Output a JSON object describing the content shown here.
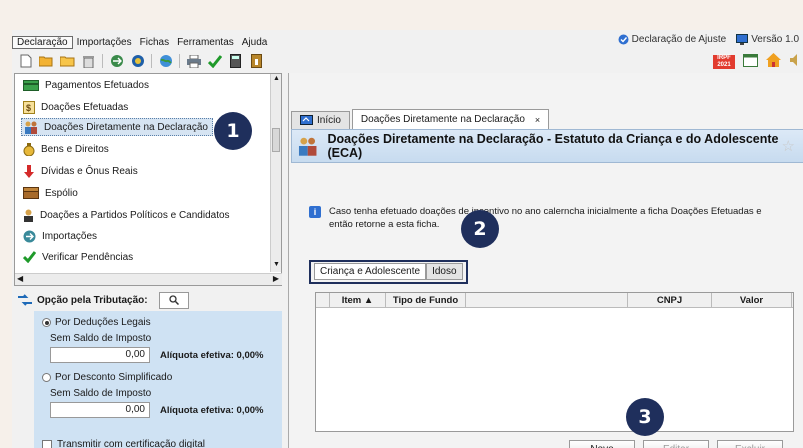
{
  "menu": {
    "items": [
      "Declaração",
      "Importações",
      "Fichas",
      "Ferramentas",
      "Ajuda"
    ],
    "right": [
      {
        "label": "Declaração de Ajuste",
        "icon": "globe-icon"
      },
      {
        "label": "Versão 1.0",
        "icon": "monitor-icon"
      }
    ]
  },
  "toolbar": {
    "icons": [
      "new-file-icon",
      "open-folder-icon",
      "folder-icon",
      "trash-icon",
      "transmit-icon",
      "receita-icon",
      "globe-world-icon",
      "print-icon",
      "check-icon",
      "calculator-icon",
      "info-book-icon"
    ],
    "right_icons": [
      "irpf-2021-icon",
      "calendar-icon",
      "home-icon",
      "sound-icon"
    ],
    "irpf_label": "IRPF",
    "irpf_year": "2021"
  },
  "tree": {
    "items": [
      {
        "label": "Pagamentos Efetuados",
        "icon": "payments-icon",
        "selected": false
      },
      {
        "label": "Doações Efetuadas",
        "icon": "donation-icon",
        "selected": false
      },
      {
        "label": "Doações Diretamente na Declaração",
        "icon": "family-icon",
        "selected": true
      },
      {
        "label": "Bens e Direitos",
        "icon": "money-bag-icon",
        "selected": false
      },
      {
        "label": "Dívidas e Ônus Reais",
        "icon": "debt-arrow-icon",
        "selected": false
      },
      {
        "label": "Espólio",
        "icon": "chest-icon",
        "selected": false
      },
      {
        "label": "Doações a Partidos Políticos e Candidatos",
        "icon": "party-icon",
        "selected": false
      },
      {
        "label": "Importações",
        "icon": "import-icon",
        "selected": false
      },
      {
        "label": "Verificar Pendências",
        "icon": "checkmark-icon",
        "selected": false
      }
    ]
  },
  "options": {
    "header": "Opção pela Tributação:",
    "deducoes": {
      "label": "Por Deduções Legais",
      "saldo_label": "Sem Saldo de Imposto",
      "value": "0,00",
      "aliquota": "Alíquota efetiva: 0,00%"
    },
    "simplificado": {
      "label": "Por Desconto Simplificado",
      "saldo_label": "Sem Saldo de Imposto",
      "value": "0,00",
      "aliquota": "Alíquota efetiva: 0,00%"
    },
    "certificado": "Transmitir com certificação digital"
  },
  "tabs": [
    {
      "label": "Início",
      "icon": "home-screen-icon",
      "active": false
    },
    {
      "label": "Doações Diretamente na Declaração",
      "active": true,
      "close": "×"
    }
  ],
  "page": {
    "title": "Doações Diretamente na Declaração - Estatuto da Criança e do Adolescente (ECA)",
    "info": "Caso tenha efetuado doações de incentivo no ano calerncha inicialmente a ficha Doações Efetuadas e então retorne a esta ficha.",
    "subtabs": [
      "Criança e Adolescente",
      "Idoso"
    ],
    "columns": [
      "Item ▲",
      "Tipo de Fundo",
      "CNPJ",
      "Valor"
    ],
    "buttons": {
      "novo": "Novo",
      "editar": "Editar",
      "excluir": "Excluir"
    }
  },
  "badges": [
    "1",
    "2",
    "3"
  ],
  "colors": {
    "badge": "#1f2f5c",
    "selected": "#d6e4f2",
    "panel": "#cfe2f3",
    "title_bar": "#c7dbef"
  }
}
